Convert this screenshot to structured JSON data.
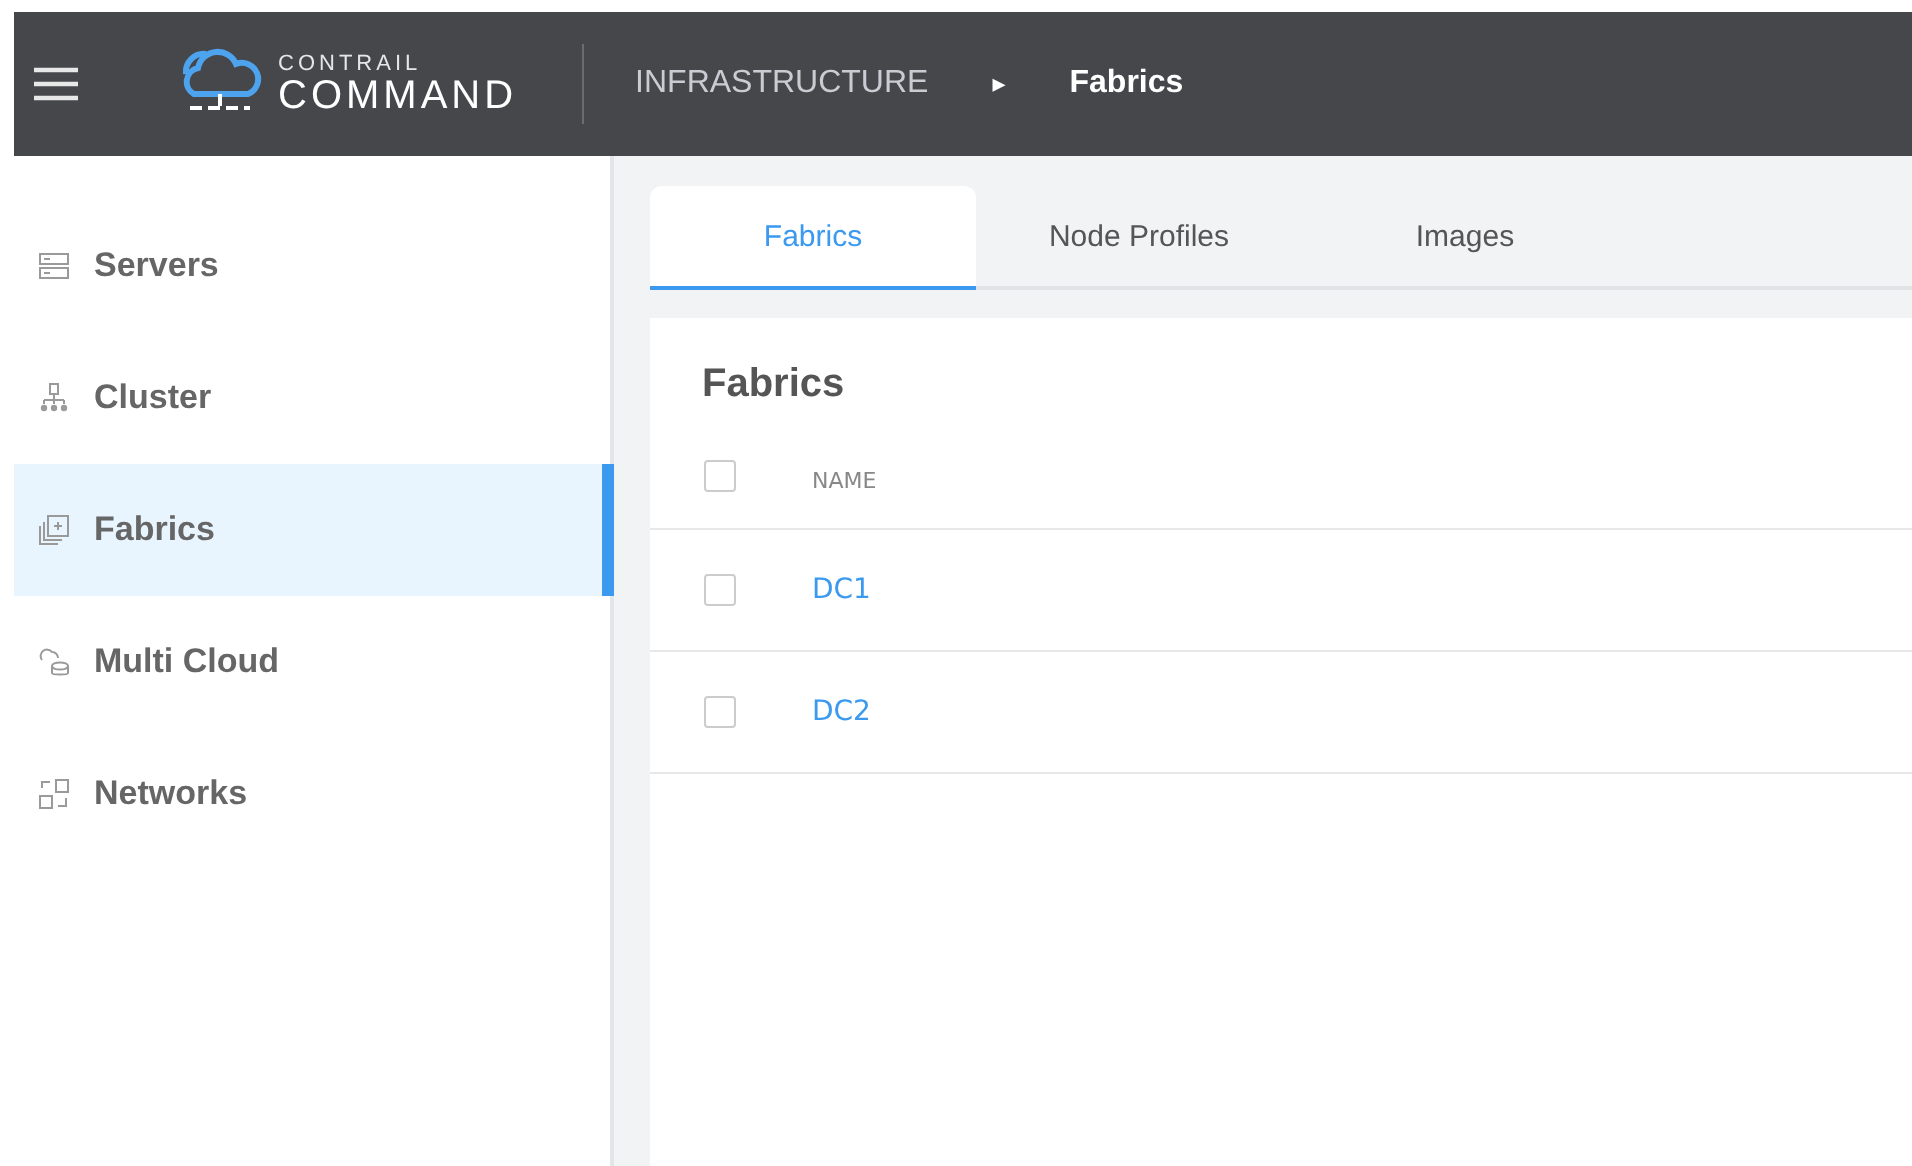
{
  "header": {
    "logo_top": "CONTRAIL",
    "logo_bottom": "COMMAND",
    "breadcrumb": [
      {
        "label": "INFRASTRUCTURE",
        "current": false
      },
      {
        "label": "Fabrics",
        "current": true
      }
    ],
    "separator": "▸"
  },
  "sidebar": {
    "items": [
      {
        "label": "Servers",
        "kind": "servers",
        "selected": false
      },
      {
        "label": "Cluster",
        "kind": "cluster",
        "selected": false
      },
      {
        "label": "Fabrics",
        "kind": "fabrics",
        "selected": true
      },
      {
        "label": "Multi Cloud",
        "kind": "cloud",
        "selected": false
      },
      {
        "label": "Networks",
        "kind": "networks",
        "selected": false
      }
    ]
  },
  "tabs": [
    {
      "label": "Fabrics",
      "selected": true
    },
    {
      "label": "Node Profiles",
      "selected": false
    },
    {
      "label": "Images",
      "selected": false
    }
  ],
  "panel": {
    "title": "Fabrics",
    "table": {
      "columns": [
        "NAME"
      ],
      "header_checked": false,
      "rows": [
        {
          "name": "DC1",
          "checked": false
        },
        {
          "name": "DC2",
          "checked": false
        }
      ]
    }
  }
}
